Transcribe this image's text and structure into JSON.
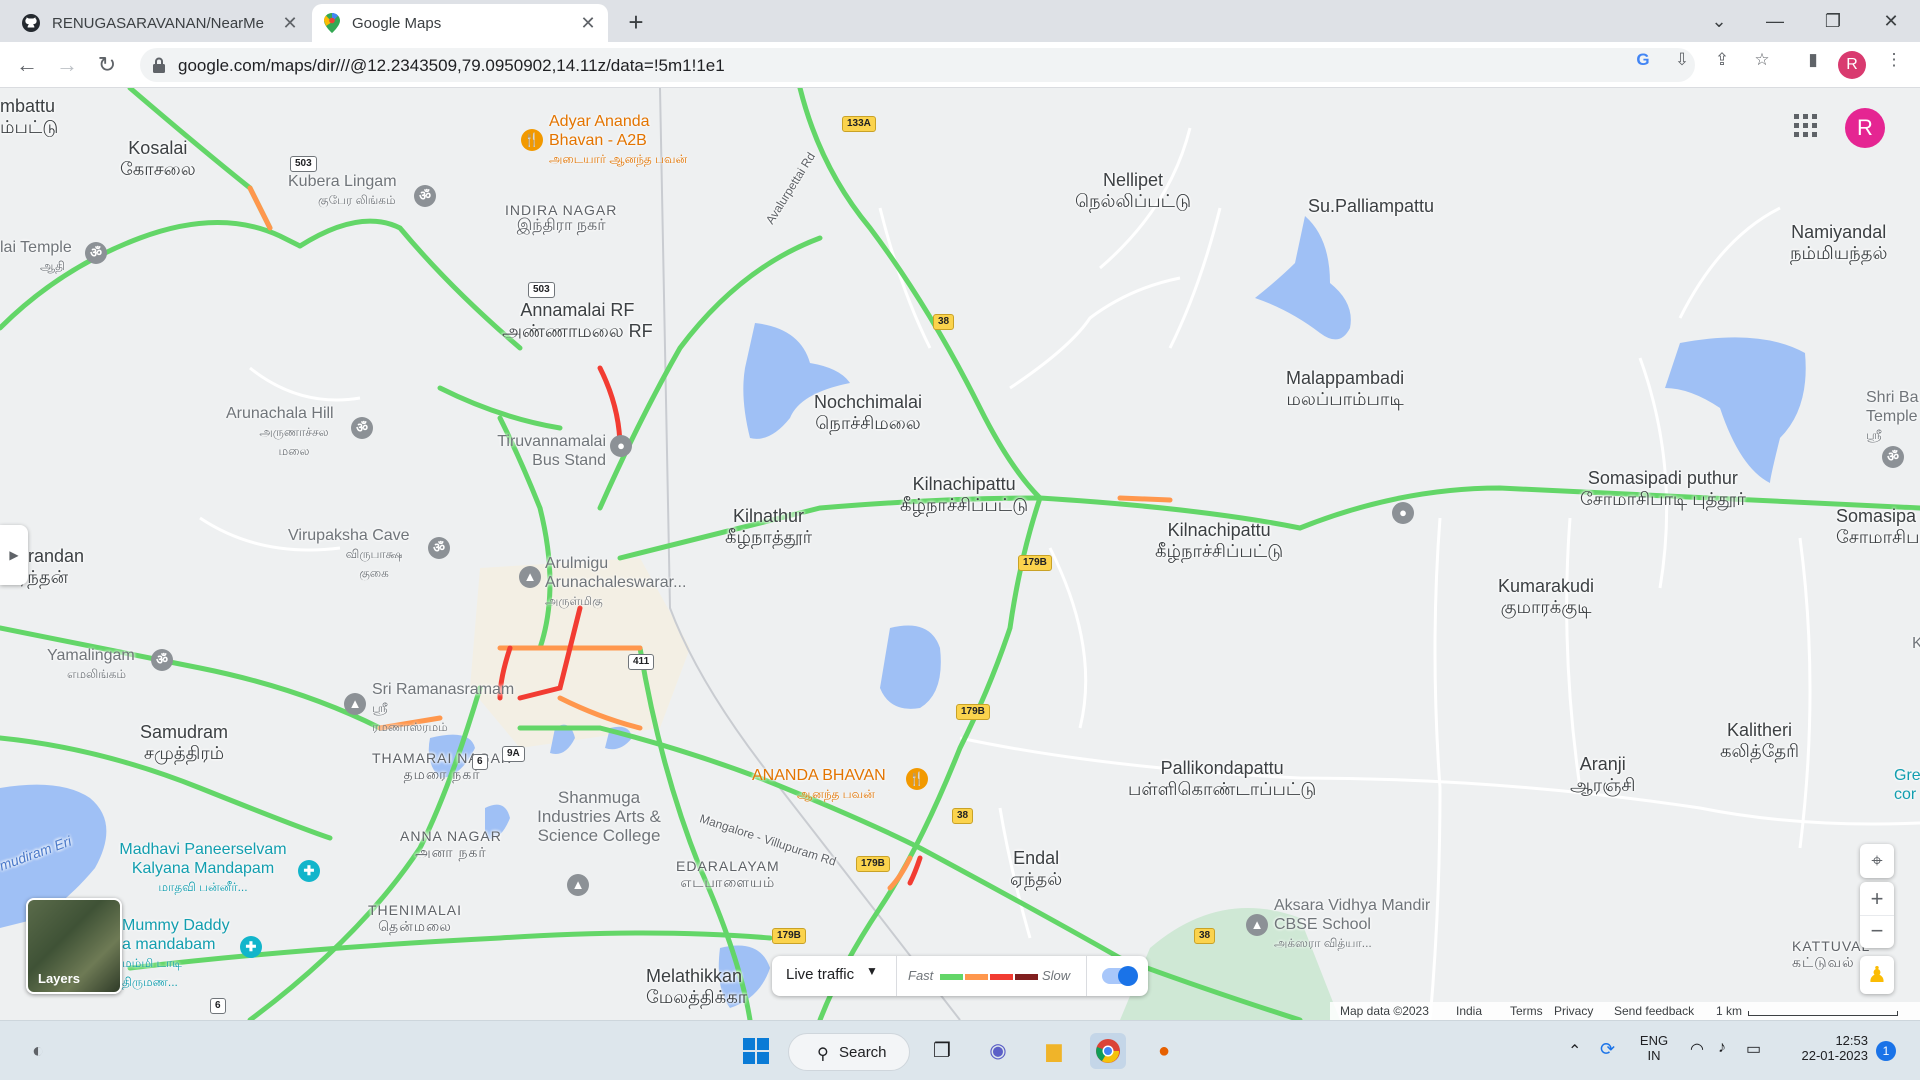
{
  "browser": {
    "tabs": [
      {
        "title": "RENUGASARAVANAN/NearMe",
        "icon": "github-icon",
        "active": false
      },
      {
        "title": "Google Maps",
        "icon": "google-maps-icon",
        "active": true
      }
    ],
    "url": "google.com/maps/dir///@12.2343509,79.0950902,14.11z/data=!5m1!1e1",
    "profile_initial": "R"
  },
  "map": {
    "profile_initial": "R",
    "places": [
      {
        "en": "mbattu",
        "ta": "ம்பட்டு"
      },
      {
        "en": "Kosalai",
        "ta": "கோசலை"
      },
      {
        "en": "INDIRA NAGAR",
        "ta": "இந்திரா நகர்"
      },
      {
        "en": "Annamalai RF",
        "ta": "அண்ணாமலை RF"
      },
      {
        "en": "Nellipet",
        "ta": "நெல்லிப்பட்டு"
      },
      {
        "en": "Su.Palliampattu",
        "ta": ""
      },
      {
        "en": "Namiyandal",
        "ta": "நம்மியந்தல்"
      },
      {
        "en": "Nochchimalai",
        "ta": "நொச்சிமலை"
      },
      {
        "en": "Malappambadi",
        "ta": "மலப்பாம்பாடி"
      },
      {
        "en": "Kilnachipattu",
        "ta": "கீழ்நாச்சிப்பட்டு"
      },
      {
        "en": "Kilnathur",
        "ta": "கீழ்நாத்தூர்"
      },
      {
        "en": "Kilnachipattu",
        "ta": "கீழ்நாச்சிப்பட்டு"
      },
      {
        "en": "Somasipadi puthur",
        "ta": "சோமாசிபாடி புத்தூர்"
      },
      {
        "en": "Somasipa",
        "ta": "சோமாசிப"
      },
      {
        "en": "urandan",
        "ta": "ரந்தன்"
      },
      {
        "en": "Kumarakudi",
        "ta": "குமாரக்குடி"
      },
      {
        "en": "Samudram",
        "ta": "சமுத்திரம்"
      },
      {
        "en": "Pallikondapattu",
        "ta": "பள்ளிகொண்டாப்பட்டு"
      },
      {
        "en": "Aranji",
        "ta": "ஆரஞ்சி"
      },
      {
        "en": "Kalitheri",
        "ta": "கலித்தேரி"
      },
      {
        "en": "Endal",
        "ta": "ஏந்தல்"
      },
      {
        "en": "Melathikkan",
        "ta": "மேலத்திக்கா"
      },
      {
        "en": "THAMARAI NAGAR",
        "ta": "தமரை நகர்"
      },
      {
        "en": "ANNA NAGAR",
        "ta": "அனா நகர்"
      },
      {
        "en": "THENIMALAI",
        "ta": "தென்மலை"
      },
      {
        "en": "EDARALAYAM",
        "ta": "எடபாளையம்"
      },
      {
        "en": "KATTUVAL",
        "ta": "கட்டுவல்"
      }
    ],
    "pois": [
      {
        "name": "Adyar Ananda Bhavan - A2B",
        "ta": "அடையார் ஆனந்த பவன்",
        "style": "orange",
        "icon": "restaurant-icon"
      },
      {
        "name": "Kubera Lingam",
        "ta": "குபேர லிங்கம்",
        "style": "gray",
        "icon": "temple-icon"
      },
      {
        "name": "lai Temple",
        "ta": "ஆதி",
        "style": "gray",
        "icon": "temple-icon"
      },
      {
        "name": "Arunachala Hill",
        "ta": "அருணாச்சல மலை",
        "style": "gray",
        "icon": "temple-icon"
      },
      {
        "name": "Tiruvannamalai Bus Stand",
        "ta": "",
        "style": "gray",
        "icon": "bus-stand-icon"
      },
      {
        "name": "Virupaksha Cave",
        "ta": "விருபாக்ஷ குகை",
        "style": "gray",
        "icon": "temple-icon"
      },
      {
        "name": "Arulmigu Arunachaleswarar...",
        "ta": "அருள்மிகு",
        "style": "gray",
        "icon": "temple-icon"
      },
      {
        "name": "Yamalingam",
        "ta": "எமலிங்கம்",
        "style": "gray",
        "icon": "temple-icon"
      },
      {
        "name": "Sri Ramanasramam",
        "ta": "ஸ்ரீ ரமணாஸ்ரமம்",
        "style": "gray",
        "icon": "temple-icon"
      },
      {
        "name": "Shanmuga Industries Arts & Science College",
        "ta": "",
        "style": "gray",
        "icon": "school-icon"
      },
      {
        "name": "ANANDA BHAVAN",
        "ta": "ஆனந்த பவன்",
        "style": "orange",
        "icon": "restaurant-icon"
      },
      {
        "name": "Madhavi Paneerselvam Kalyana Mandapam",
        "ta": "மாதவி பன்னீர்...",
        "style": "teal",
        "icon": "hall-icon"
      },
      {
        "name": "Mummy Daddy a mandabam",
        "ta": "மம்மி டாடி திருமண...",
        "style": "teal",
        "icon": "hall-icon"
      },
      {
        "name": "Aksara Vidhya Mandir CBSE School",
        "ta": "அக்ஸரா வித்யா...",
        "style": "gray",
        "icon": "school-icon"
      },
      {
        "name": "Shri Ba Temple",
        "ta": "ஸ்ரீ",
        "style": "gray",
        "icon": "temple-icon"
      },
      {
        "name": "Gre cor",
        "ta": "",
        "style": "teal",
        "icon": ""
      },
      {
        "name": "K",
        "ta": "",
        "style": "gray",
        "icon": ""
      }
    ],
    "road_shields": [
      "133A",
      "503",
      "503",
      "38",
      "179B",
      "179B",
      "411",
      "9A",
      "6",
      "38",
      "179B",
      "179B",
      "38",
      "6"
    ],
    "road_labels": [
      "Avalurpettai Rd",
      "Mangalore - Villupuram Rd"
    ],
    "water_labels": [
      "mudiram Eri"
    ],
    "controls": {
      "layers_label": "Layers",
      "live_traffic_label": "Live traffic",
      "fast_label": "Fast",
      "slow_label": "Slow",
      "traffic_colors": [
        "#63d668",
        "#ff974d",
        "#f23c32",
        "#811f1f"
      ],
      "traffic_on": true
    },
    "footer": {
      "map_data": "Map data ©2023",
      "country": "India",
      "terms": "Terms",
      "privacy": "Privacy",
      "feedback": "Send feedback",
      "scale": "1 km"
    }
  },
  "taskbar": {
    "search_label": "Search",
    "lang_top": "ENG",
    "lang_bottom": "IN",
    "time": "12:53",
    "date": "22-01-2023",
    "notification_count": "1"
  }
}
